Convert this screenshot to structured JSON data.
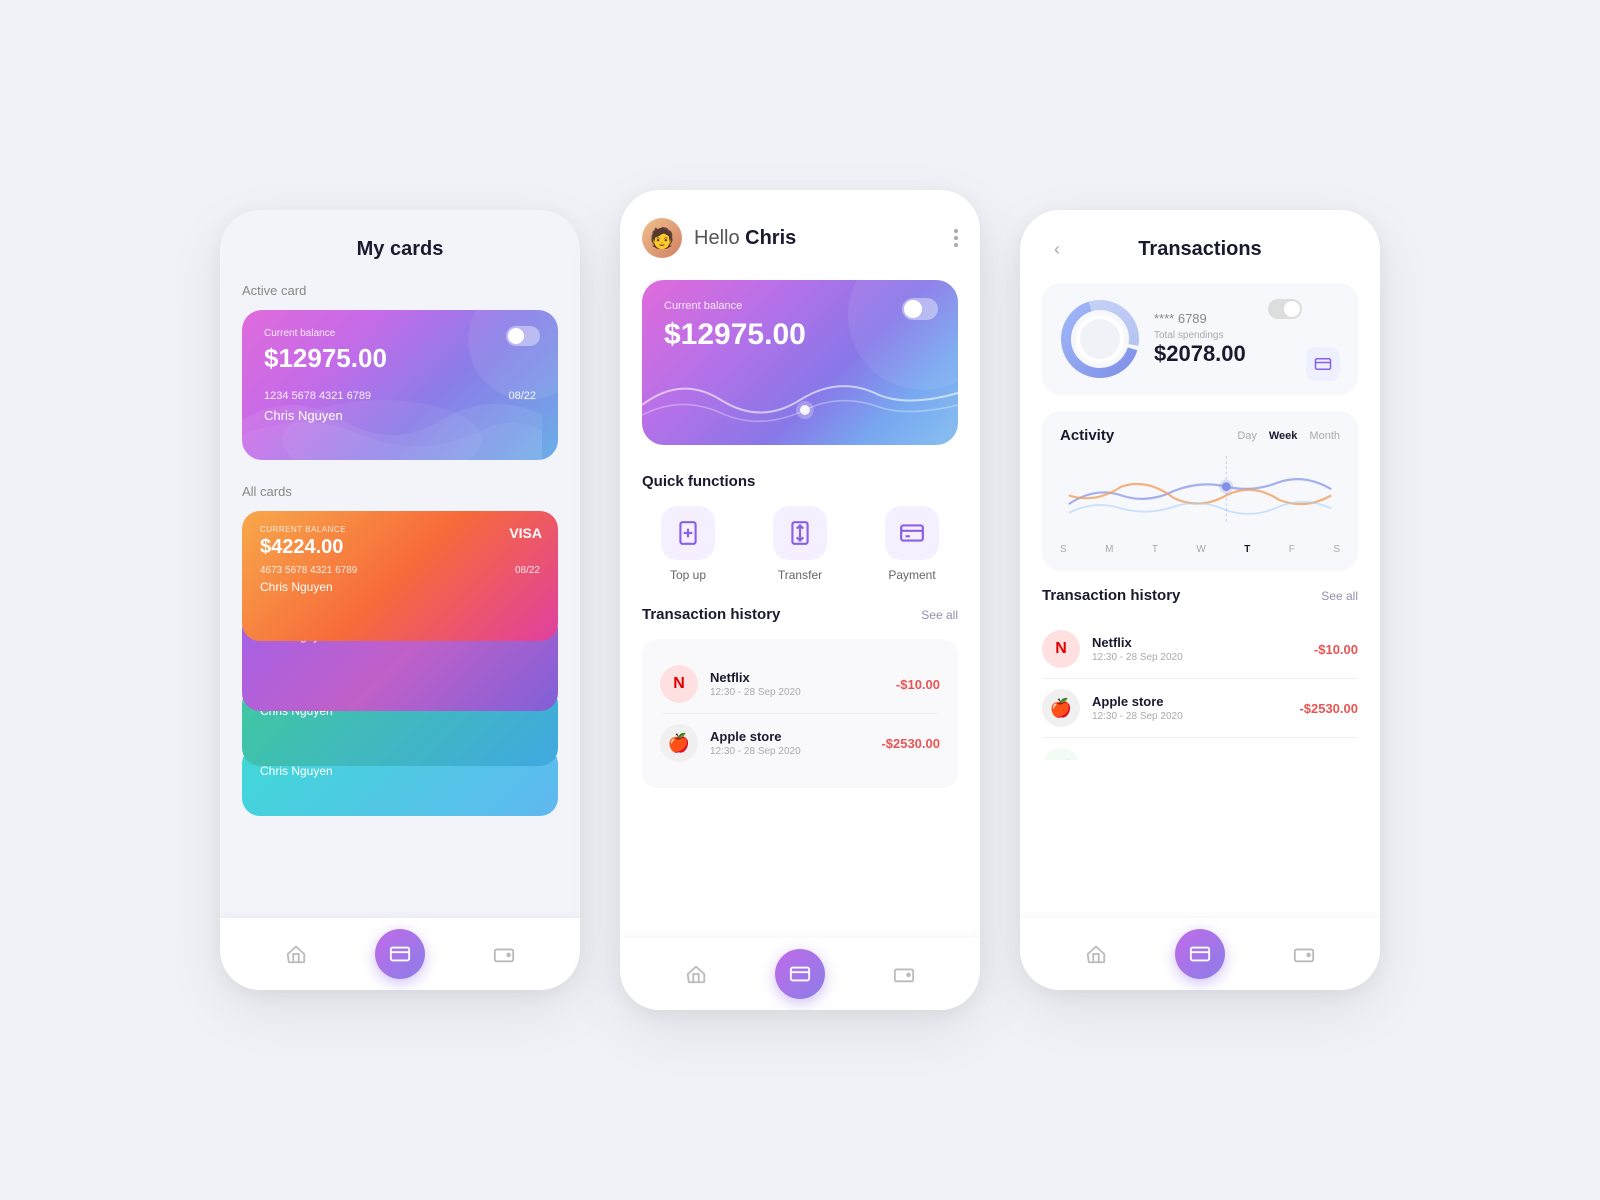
{
  "left": {
    "title": "My cards",
    "active_card_label": "Active card",
    "all_cards_label": "All cards",
    "active_card": {
      "balance_label": "Current balance",
      "balance": "$12975.00",
      "number": "1234  5678  4321  6789",
      "expiry": "08/22",
      "holder": "Chris Nguyen"
    },
    "stacked_cards": [
      {
        "label": "CURRENT BALANCE",
        "amount": "$4224.00",
        "number": "4673  5678  4321  6789",
        "expiry": "08/22",
        "holder": "Chris Nguyen",
        "brand": "VISA",
        "gradient": "linear-gradient(135deg, #f7a84a, #f76a3a, #e040a0)"
      },
      {
        "holder": "Chris Nguyen",
        "gradient": "linear-gradient(135deg, #a560e8, #c060c8, #8060d8)"
      },
      {
        "holder": "Chris Nguyen",
        "gradient": "linear-gradient(135deg, #40c8a0, #40a8e0)"
      },
      {
        "holder": "Chris Nguyen",
        "gradient": "linear-gradient(135deg, #40d8d8, #60b8f0)"
      }
    ]
  },
  "middle": {
    "greeting": "Hello ",
    "user_name": "Chris",
    "card": {
      "balance_label": "Current balance",
      "balance": "$12975.00"
    },
    "quick_functions_label": "Quick functions",
    "functions": [
      {
        "icon": "top-up",
        "label": "Top up"
      },
      {
        "icon": "transfer",
        "label": "Transfer"
      },
      {
        "icon": "payment",
        "label": "Payment"
      }
    ],
    "transaction_history_label": "Transaction history",
    "see_all": "See all",
    "transactions": [
      {
        "name": "Netflix",
        "date": "12:30 - 28 Sep 2020",
        "amount": "-$10.00",
        "icon": "N"
      },
      {
        "name": "Apple store",
        "date": "12:30 - 28 Sep 2020",
        "amount": "-$2530.00",
        "icon": ""
      }
    ]
  },
  "right": {
    "title": "Transactions",
    "card_last4": "**** 6789",
    "total_spendings_label": "Total spendings",
    "total_spendings": "$2078.00",
    "switch_card_label": "Switch card",
    "activity_label": "Activity",
    "activity_tabs": [
      "Day",
      "Week",
      "Month"
    ],
    "active_tab": "Week",
    "chart_days": [
      "S",
      "M",
      "T",
      "W",
      "T",
      "F",
      "S"
    ],
    "highlighted_day": "T",
    "transaction_history_label": "Transaction history",
    "see_all": "See all",
    "transactions": [
      {
        "name": "Netflix",
        "date": "12:30 - 28 Sep 2020",
        "amount": "-$10.00",
        "icon": "N"
      },
      {
        "name": "Apple store",
        "date": "12:30 - 28 Sep 2020",
        "amount": "-$2530.00",
        "icon": ""
      }
    ]
  },
  "nav": {
    "home_icon": "⌂",
    "cards_icon": "▣",
    "wallet_icon": "◫"
  }
}
